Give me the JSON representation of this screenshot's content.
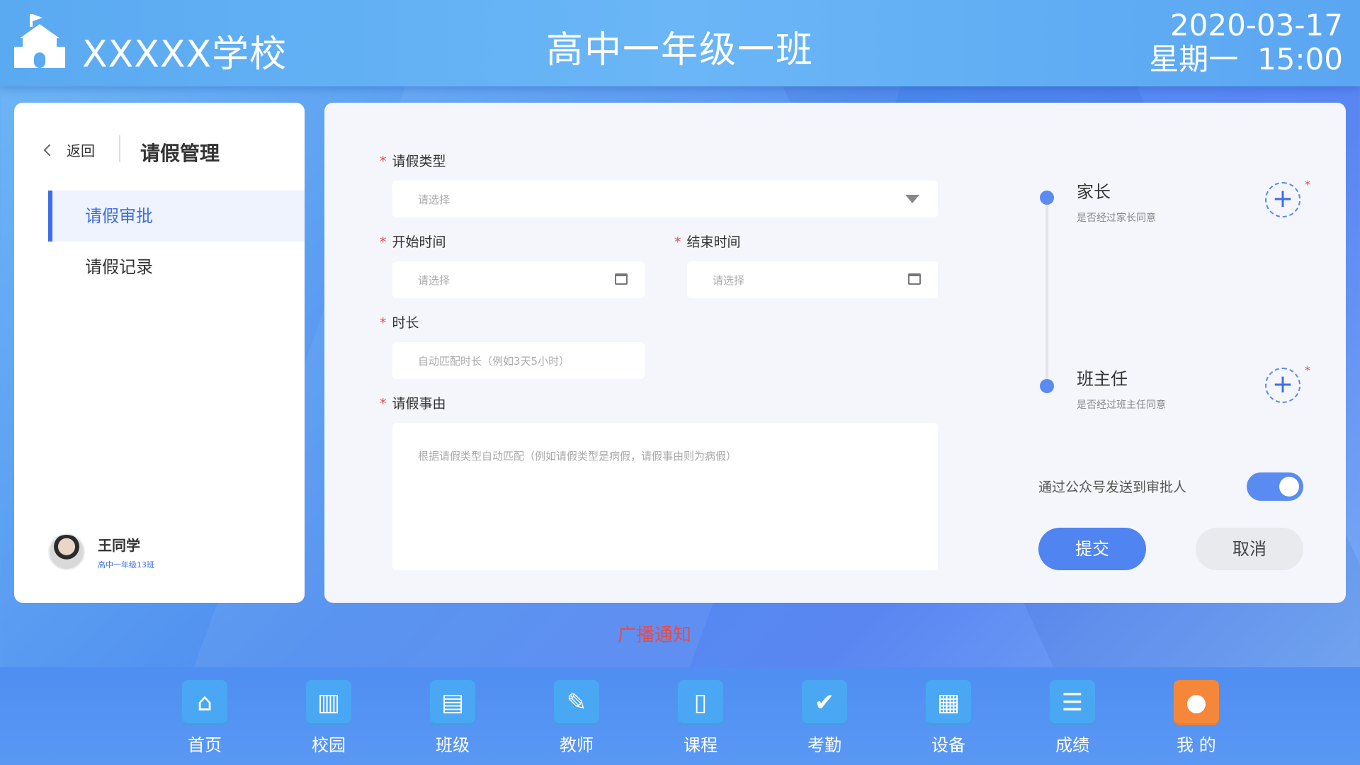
{
  "header": {
    "school_name": "XXXXX学校",
    "class_title": "高中一年级一班",
    "date": "2020-03-17",
    "weekday_time": "星期一  15:00"
  },
  "sidebar": {
    "back_label": "返回",
    "title": "请假管理",
    "items": [
      {
        "label": "请假审批",
        "active": true
      },
      {
        "label": "请假记录",
        "active": false
      }
    ],
    "user": {
      "name": "王同学",
      "class": "高中一年级13班"
    }
  },
  "form": {
    "required_mark": "*",
    "leave_type": {
      "label": "请假类型",
      "placeholder": "请选择"
    },
    "start_time": {
      "label": "开始时间",
      "placeholder": "请选择"
    },
    "end_time": {
      "label": "结束时间",
      "placeholder": "请选择"
    },
    "duration": {
      "label": "时长",
      "placeholder": "自动匹配时长（例如3天5小时）"
    },
    "reason": {
      "label": "请假事由",
      "placeholder": "根据请假类型自动匹配（例如请假类型是病假，请假事由则为病假）"
    }
  },
  "approval": {
    "steps": [
      {
        "title": "家长",
        "subtitle": "是否经过家长同意"
      },
      {
        "title": "班主任",
        "subtitle": "是否经过班主任同意"
      }
    ],
    "add_symbol": "+",
    "toggle_label": "通过公众号发送到审批人",
    "toggle_on": true,
    "submit_label": "提交",
    "cancel_label": "取消"
  },
  "broadcast": "广播通知",
  "nav": {
    "items": [
      {
        "label": "首页",
        "icon": "home-icon"
      },
      {
        "label": "校园",
        "icon": "campus-icon"
      },
      {
        "label": "班级",
        "icon": "class-icon"
      },
      {
        "label": "教师",
        "icon": "teacher-icon"
      },
      {
        "label": "课程",
        "icon": "course-icon"
      },
      {
        "label": "考勤",
        "icon": "attendance-icon"
      },
      {
        "label": "设备",
        "icon": "device-icon"
      },
      {
        "label": "成绩",
        "icon": "grades-icon"
      },
      {
        "label": "我 的",
        "icon": "user-icon"
      }
    ]
  },
  "colors": {
    "accent": "#3b6ee8",
    "required": "#e84a4a",
    "active_nav": "#f5873a"
  }
}
